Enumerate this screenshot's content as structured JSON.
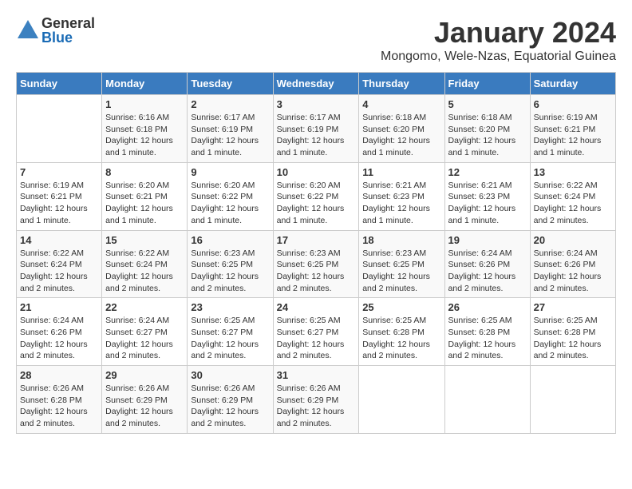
{
  "logo": {
    "general": "General",
    "blue": "Blue"
  },
  "title": "January 2024",
  "subtitle": "Mongomo, Wele-Nzas, Equatorial Guinea",
  "days_header": [
    "Sunday",
    "Monday",
    "Tuesday",
    "Wednesday",
    "Thursday",
    "Friday",
    "Saturday"
  ],
  "weeks": [
    [
      {
        "num": "",
        "info": ""
      },
      {
        "num": "1",
        "info": "Sunrise: 6:16 AM\nSunset: 6:18 PM\nDaylight: 12 hours\nand 1 minute."
      },
      {
        "num": "2",
        "info": "Sunrise: 6:17 AM\nSunset: 6:19 PM\nDaylight: 12 hours\nand 1 minute."
      },
      {
        "num": "3",
        "info": "Sunrise: 6:17 AM\nSunset: 6:19 PM\nDaylight: 12 hours\nand 1 minute."
      },
      {
        "num": "4",
        "info": "Sunrise: 6:18 AM\nSunset: 6:20 PM\nDaylight: 12 hours\nand 1 minute."
      },
      {
        "num": "5",
        "info": "Sunrise: 6:18 AM\nSunset: 6:20 PM\nDaylight: 12 hours\nand 1 minute."
      },
      {
        "num": "6",
        "info": "Sunrise: 6:19 AM\nSunset: 6:21 PM\nDaylight: 12 hours\nand 1 minute."
      }
    ],
    [
      {
        "num": "7",
        "info": "Sunrise: 6:19 AM\nSunset: 6:21 PM\nDaylight: 12 hours\nand 1 minute."
      },
      {
        "num": "8",
        "info": "Sunrise: 6:20 AM\nSunset: 6:21 PM\nDaylight: 12 hours\nand 1 minute."
      },
      {
        "num": "9",
        "info": "Sunrise: 6:20 AM\nSunset: 6:22 PM\nDaylight: 12 hours\nand 1 minute."
      },
      {
        "num": "10",
        "info": "Sunrise: 6:20 AM\nSunset: 6:22 PM\nDaylight: 12 hours\nand 1 minute."
      },
      {
        "num": "11",
        "info": "Sunrise: 6:21 AM\nSunset: 6:23 PM\nDaylight: 12 hours\nand 1 minute."
      },
      {
        "num": "12",
        "info": "Sunrise: 6:21 AM\nSunset: 6:23 PM\nDaylight: 12 hours\nand 1 minute."
      },
      {
        "num": "13",
        "info": "Sunrise: 6:22 AM\nSunset: 6:24 PM\nDaylight: 12 hours\nand 2 minutes."
      }
    ],
    [
      {
        "num": "14",
        "info": "Sunrise: 6:22 AM\nSunset: 6:24 PM\nDaylight: 12 hours\nand 2 minutes."
      },
      {
        "num": "15",
        "info": "Sunrise: 6:22 AM\nSunset: 6:24 PM\nDaylight: 12 hours\nand 2 minutes."
      },
      {
        "num": "16",
        "info": "Sunrise: 6:23 AM\nSunset: 6:25 PM\nDaylight: 12 hours\nand 2 minutes."
      },
      {
        "num": "17",
        "info": "Sunrise: 6:23 AM\nSunset: 6:25 PM\nDaylight: 12 hours\nand 2 minutes."
      },
      {
        "num": "18",
        "info": "Sunrise: 6:23 AM\nSunset: 6:25 PM\nDaylight: 12 hours\nand 2 minutes."
      },
      {
        "num": "19",
        "info": "Sunrise: 6:24 AM\nSunset: 6:26 PM\nDaylight: 12 hours\nand 2 minutes."
      },
      {
        "num": "20",
        "info": "Sunrise: 6:24 AM\nSunset: 6:26 PM\nDaylight: 12 hours\nand 2 minutes."
      }
    ],
    [
      {
        "num": "21",
        "info": "Sunrise: 6:24 AM\nSunset: 6:26 PM\nDaylight: 12 hours\nand 2 minutes."
      },
      {
        "num": "22",
        "info": "Sunrise: 6:24 AM\nSunset: 6:27 PM\nDaylight: 12 hours\nand 2 minutes."
      },
      {
        "num": "23",
        "info": "Sunrise: 6:25 AM\nSunset: 6:27 PM\nDaylight: 12 hours\nand 2 minutes."
      },
      {
        "num": "24",
        "info": "Sunrise: 6:25 AM\nSunset: 6:27 PM\nDaylight: 12 hours\nand 2 minutes."
      },
      {
        "num": "25",
        "info": "Sunrise: 6:25 AM\nSunset: 6:28 PM\nDaylight: 12 hours\nand 2 minutes."
      },
      {
        "num": "26",
        "info": "Sunrise: 6:25 AM\nSunset: 6:28 PM\nDaylight: 12 hours\nand 2 minutes."
      },
      {
        "num": "27",
        "info": "Sunrise: 6:25 AM\nSunset: 6:28 PM\nDaylight: 12 hours\nand 2 minutes."
      }
    ],
    [
      {
        "num": "28",
        "info": "Sunrise: 6:26 AM\nSunset: 6:28 PM\nDaylight: 12 hours\nand 2 minutes."
      },
      {
        "num": "29",
        "info": "Sunrise: 6:26 AM\nSunset: 6:29 PM\nDaylight: 12 hours\nand 2 minutes."
      },
      {
        "num": "30",
        "info": "Sunrise: 6:26 AM\nSunset: 6:29 PM\nDaylight: 12 hours\nand 2 minutes."
      },
      {
        "num": "31",
        "info": "Sunrise: 6:26 AM\nSunset: 6:29 PM\nDaylight: 12 hours\nand 2 minutes."
      },
      {
        "num": "",
        "info": ""
      },
      {
        "num": "",
        "info": ""
      },
      {
        "num": "",
        "info": ""
      }
    ]
  ]
}
